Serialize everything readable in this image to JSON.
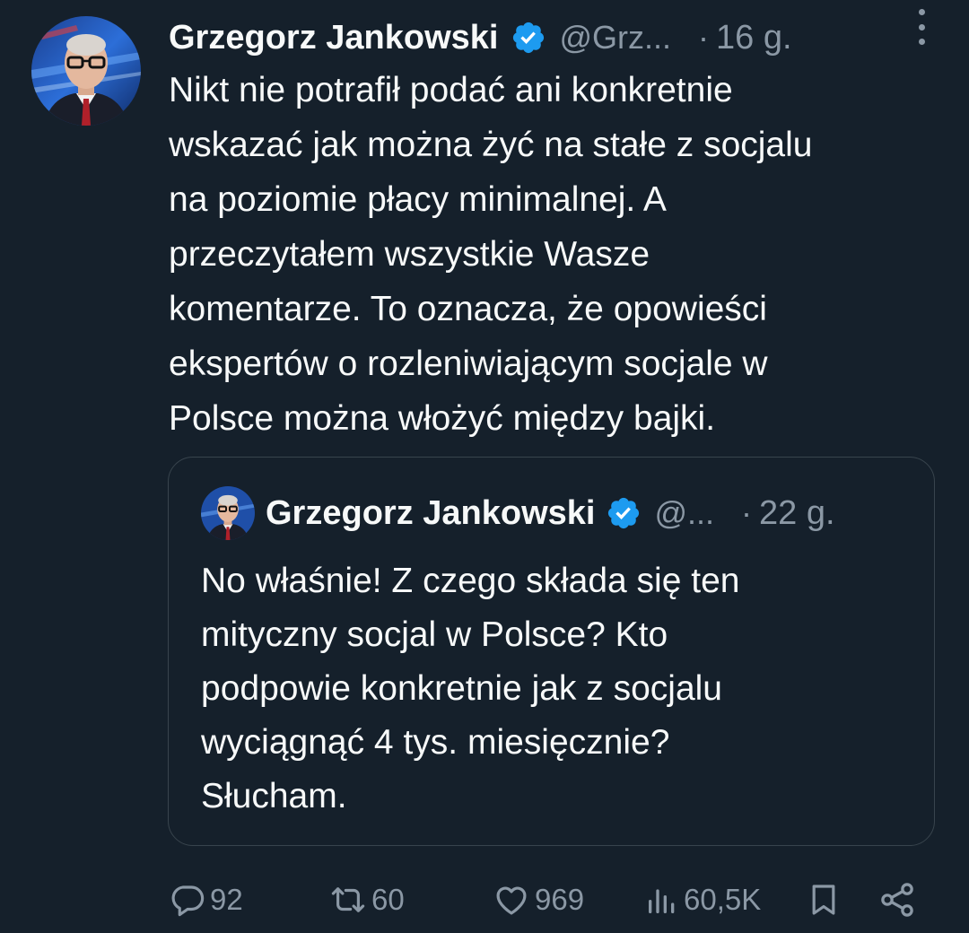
{
  "tweet": {
    "author": {
      "name": "Grzegorz Jankowski",
      "handle": "@Grz...",
      "verified": true
    },
    "time_dot": "·",
    "time": "16 g.",
    "text_lines": [
      "Nikt nie potrafił podać ani konkretnie",
      "wskazać jak można żyć na stałe z socjalu",
      "na poziomie płacy minimalnej. A",
      "przeczytałem wszystkie Wasze",
      "komentarze. To oznacza, że opowieści",
      "ekspertów o rozleniwiającym socjale w",
      "Polsce można włożyć między bajki."
    ],
    "more_icon": "more-vertical-icon"
  },
  "quoted": {
    "author": {
      "name": "Grzegorz Jankowski",
      "handle": "@...",
      "verified": true
    },
    "time_dot": "·",
    "time": "22 g.",
    "text_lines": [
      "No właśnie! Z czego składa się ten",
      "mityczny socjal w Polsce? Kto",
      "podpowie konkretnie jak z socjalu",
      "wyciągnąć 4 tys. miesięcznie?",
      "Słucham."
    ]
  },
  "actions": {
    "replies": "92",
    "reposts": "60",
    "likes": "969",
    "views": "60,5K",
    "icons": [
      "reply-icon",
      "repost-icon",
      "like-icon",
      "views-icon",
      "bookmark-icon",
      "share-icon"
    ]
  },
  "colors": {
    "background": "#15202b",
    "text": "#f7f9f9",
    "secondary": "#8b98a5",
    "border": "#38444d",
    "verified": "#1d9bf0"
  }
}
